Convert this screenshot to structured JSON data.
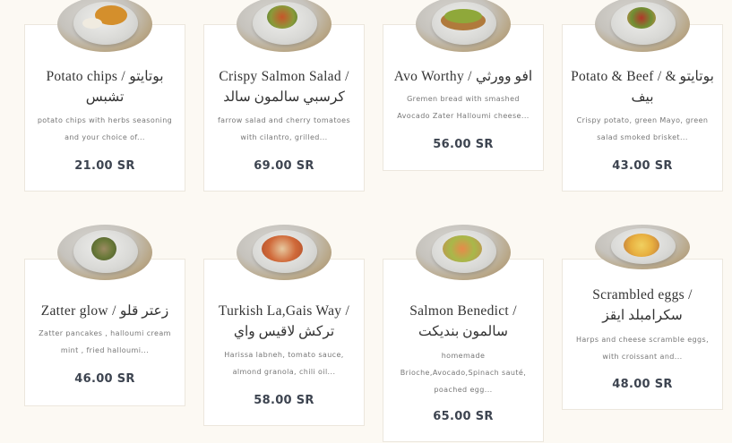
{
  "menu": [
    {
      "title": "Potato chips / بوتايتو تشبس",
      "desc": "potato chips with herbs seasoning and your choice of...",
      "price": "21.00 SR",
      "img": "potato-chips-photo"
    },
    {
      "title": "Crispy Salmon Salad / كرسبي سالمون سالد",
      "desc": "farrow salad and cherry tomatoes with cilantro, grilled...",
      "price": "69.00 SR",
      "img": "salmon-salad-photo"
    },
    {
      "title": "Avo Worthy / افو وورثي",
      "desc": "Gremen bread with smashed Avocado Zater Halloumi cheese...",
      "price": "56.00 SR",
      "img": "avocado-toast-photo"
    },
    {
      "title": "Potato & Beef / بوتايتو & بيف",
      "desc": "Crispy potato, green Mayo, green salad smoked brisket...",
      "price": "43.00 SR",
      "img": "potato-beef-photo"
    },
    {
      "title": "Zatter glow / زعتر قلو",
      "desc": "Zatter pancakes , halloumi cream mint , fried halloumi...",
      "price": "46.00 SR",
      "img": "zatter-glow-photo"
    },
    {
      "title": "Turkish La,Gais Way / تركش لاقيس واي",
      "desc": "Harissa labneh, tomato sauce, almond granola, chili oil...",
      "price": "58.00 SR",
      "img": "turkish-eggs-photo"
    },
    {
      "title": "Salmon Benedict / سالمون بنديكت",
      "desc": "homemade Brioche,Avocado,Spinach sauté, poached egg...",
      "price": "65.00 SR",
      "img": "salmon-benedict-photo"
    },
    {
      "title": "Scrambled eggs / سكرامبلد ايقز",
      "desc": "Harps and cheese scramble eggs, with croissant and...",
      "price": "48.00 SR",
      "img": "scrambled-eggs-photo"
    }
  ]
}
